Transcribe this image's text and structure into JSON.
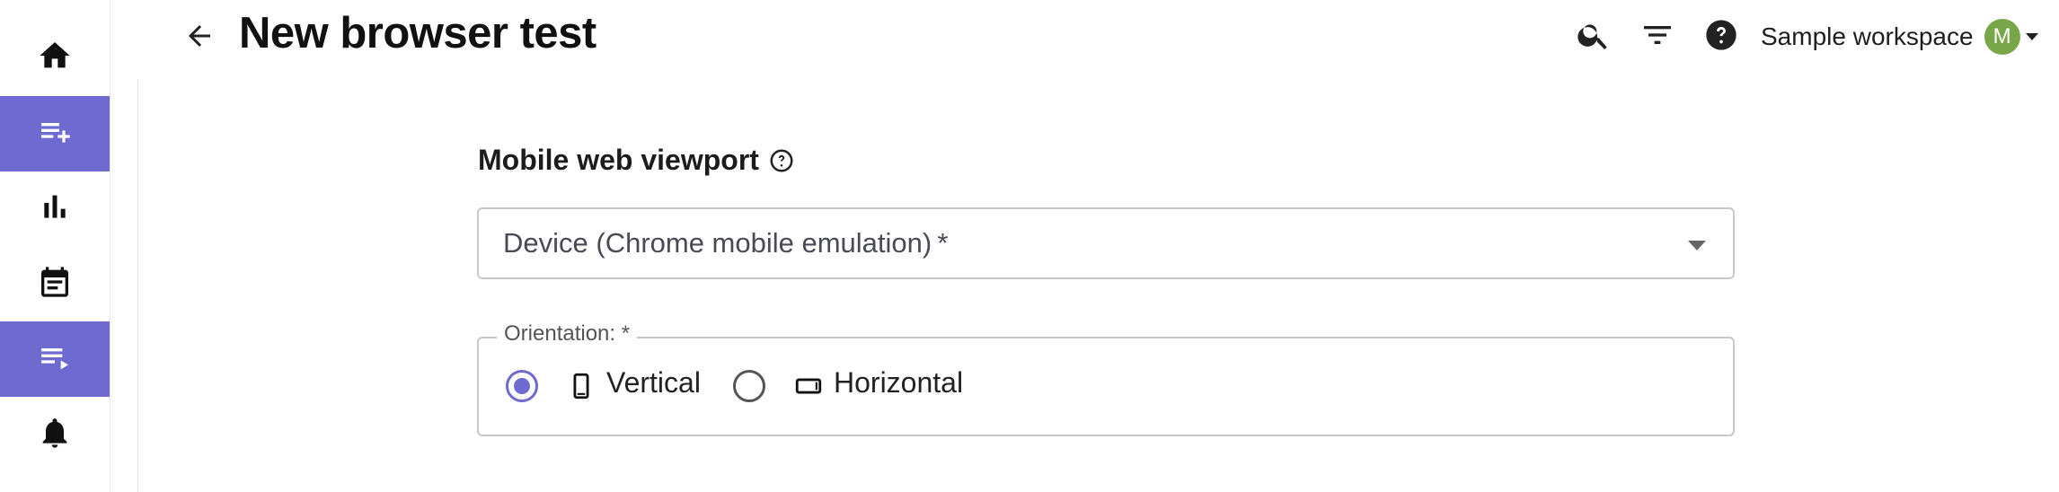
{
  "header": {
    "title": "New browser test",
    "workspace_name": "Sample workspace",
    "avatar_initial": "M"
  },
  "sidebar": {
    "items": [
      {
        "icon": "home-icon",
        "active": false
      },
      {
        "icon": "playlist-add-icon",
        "active": true
      },
      {
        "icon": "bar-chart-icon",
        "active": false
      },
      {
        "icon": "calendar-icon",
        "active": false
      },
      {
        "icon": "playlist-play-icon",
        "active": true
      },
      {
        "icon": "bell-icon",
        "active": false
      }
    ]
  },
  "form": {
    "section_label": "Mobile web viewport",
    "device_select_value": "Device (Chrome mobile emulation) *",
    "orientation_legend": "Orientation: *",
    "options": [
      {
        "label": "Vertical",
        "icon": "phone-portrait-icon",
        "selected": true
      },
      {
        "label": "Horizontal",
        "icon": "phone-landscape-icon",
        "selected": false
      }
    ]
  },
  "colors": {
    "accent": "#6e6ad0",
    "avatar": "#7aa64a"
  }
}
